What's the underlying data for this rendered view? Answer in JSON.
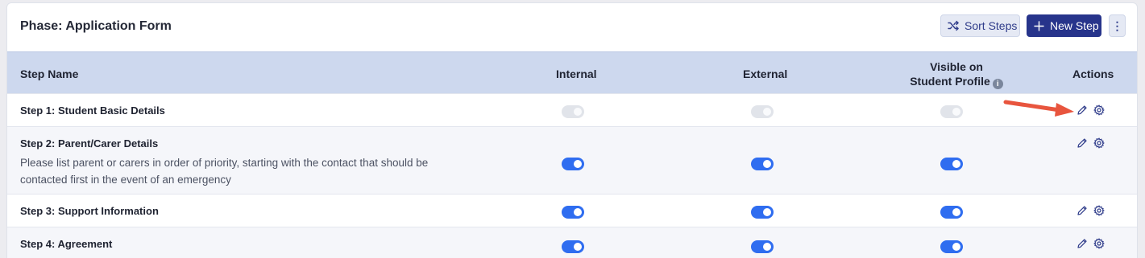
{
  "phase": {
    "title": "Phase: Application Form"
  },
  "toolbar": {
    "sort_label": "Sort Steps",
    "new_label": "New Step",
    "more_label": "⋮"
  },
  "table": {
    "columns": {
      "name": "Step Name",
      "internal": "Internal",
      "external": "External",
      "visible_line1": "Visible on",
      "visible_line2": "Student Profile",
      "actions": "Actions"
    },
    "info_glyph": "i",
    "rows": [
      {
        "title": "Step 1: Student Basic Details",
        "description": "",
        "internal": true,
        "external": true,
        "visible": true,
        "disabled": true
      },
      {
        "title": "Step 2: Parent/Carer Details",
        "description": "Please list parent or carers in order of priority, starting with the contact that should be contacted first in the event of an emergency",
        "internal": true,
        "external": true,
        "visible": true,
        "disabled": false
      },
      {
        "title": "Step 3: Support Information",
        "description": "",
        "internal": true,
        "external": true,
        "visible": true,
        "disabled": false
      },
      {
        "title": "Step 4: Agreement",
        "description": "",
        "internal": true,
        "external": true,
        "visible": true,
        "disabled": false
      }
    ]
  },
  "colors": {
    "primary": "#27348b",
    "toggle_on": "#2f6df0",
    "header_bg": "#cdd8ee",
    "annotation": "#e8553e"
  },
  "icons": [
    "shuffle-icon",
    "plus-icon",
    "info-icon",
    "pencil-icon",
    "gear-icon",
    "annotation-arrow"
  ]
}
